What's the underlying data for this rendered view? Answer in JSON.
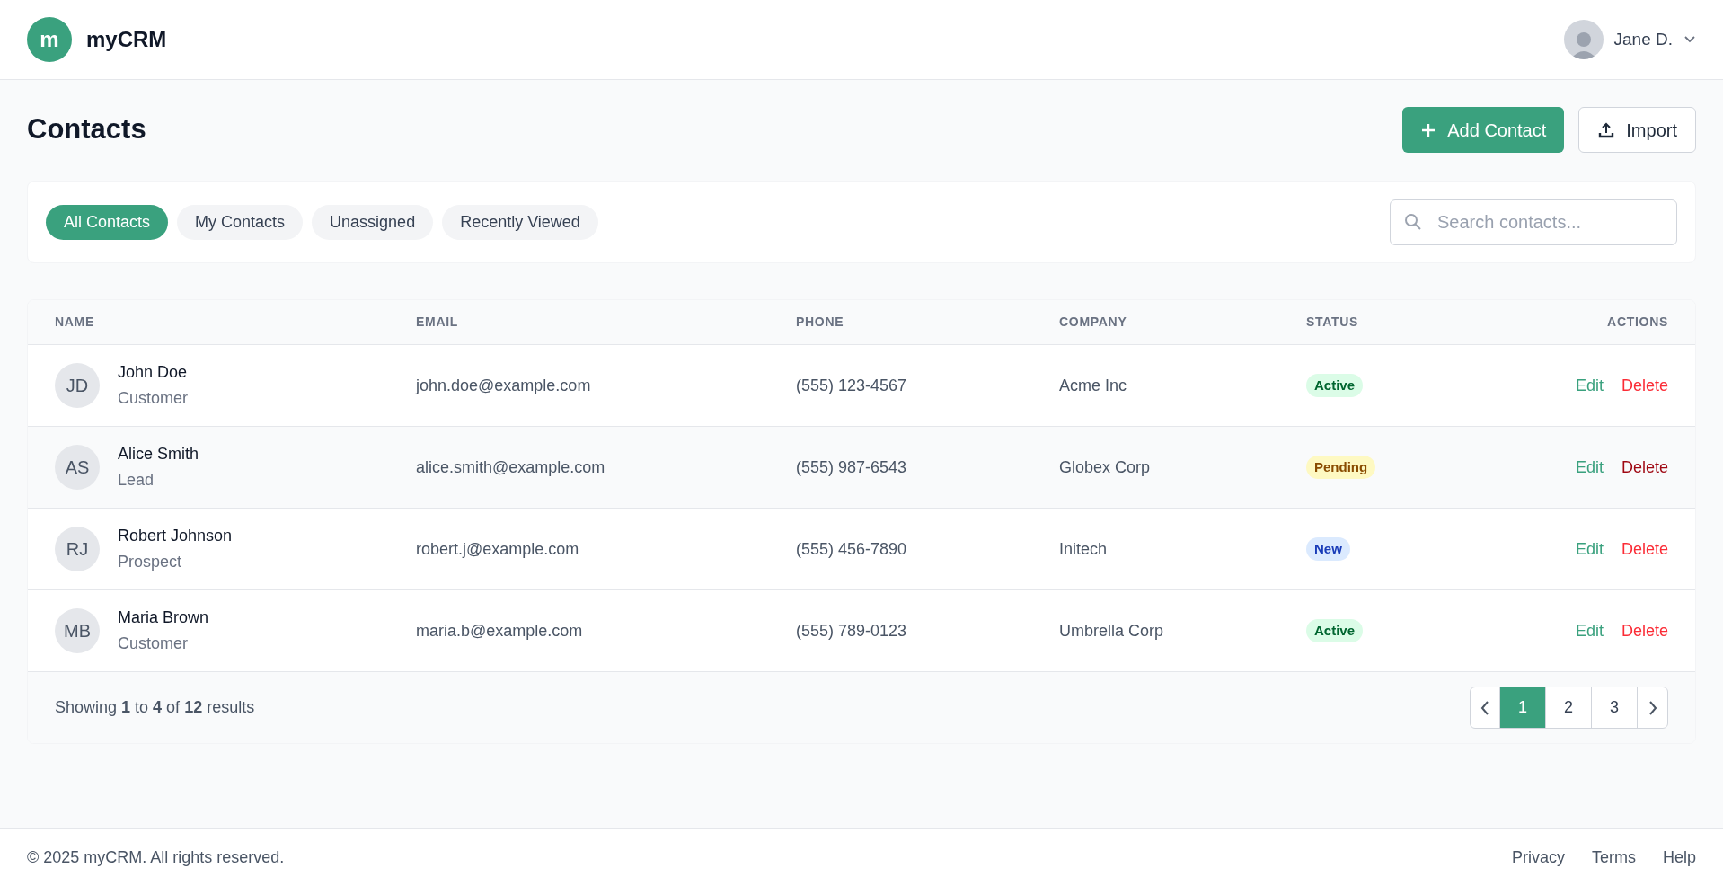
{
  "header": {
    "logo_letter": "m",
    "app_name": "myCRM",
    "user_name": "Jane D."
  },
  "page": {
    "title": "Contacts",
    "buttons": [
      {
        "kind": "primary",
        "label": "Add Contact"
      },
      {
        "kind": "secondary",
        "label": "Import"
      }
    ]
  },
  "filters": {
    "tabs": [
      {
        "label": "All Contacts",
        "selected": true
      },
      {
        "label": "My Contacts",
        "selected": false
      },
      {
        "label": "Unassigned",
        "selected": false
      },
      {
        "label": "Recently Viewed",
        "selected": false
      }
    ],
    "search": {
      "placeholder": "Search contacts..."
    }
  },
  "table": {
    "columns": [
      "NAME",
      "EMAIL",
      "PHONE",
      "COMPANY",
      "STATUS",
      "ACTIONS"
    ],
    "rows": [
      {
        "initials": "JD",
        "name": "John Doe",
        "type": "Customer",
        "email": "john.doe@example.com",
        "phone": "(555) 123-4567",
        "company": "Acme Inc",
        "status": {
          "label": "Active",
          "kind": "active"
        },
        "actions": [
          "Edit",
          "Delete"
        ],
        "highlighted": false
      },
      {
        "initials": "AS",
        "name": "Alice Smith",
        "type": "Lead",
        "email": "alice.smith@example.com",
        "phone": "(555) 987-6543",
        "company": "Globex Corp",
        "status": {
          "label": "Pending",
          "kind": "pending"
        },
        "actions": [
          "Edit",
          "Delete"
        ],
        "highlighted": true
      },
      {
        "initials": "RJ",
        "name": "Robert Johnson",
        "type": "Prospect",
        "email": "robert.j@example.com",
        "phone": "(555) 456-7890",
        "company": "Initech",
        "status": {
          "label": "New",
          "kind": "new"
        },
        "actions": [
          "Edit",
          "Delete"
        ],
        "highlighted": false
      },
      {
        "initials": "MB",
        "name": "Maria Brown",
        "type": "Customer",
        "email": "maria.b@example.com",
        "phone": "(555) 789-0123",
        "company": "Umbrella Corp",
        "status": {
          "label": "Active",
          "kind": "active"
        },
        "actions": [
          "Edit",
          "Delete"
        ],
        "highlighted": false
      }
    ],
    "summary": "Showing **1** to **4** of **12** results",
    "pagination": {
      "pages": [
        {
          "label": "1",
          "selected": true
        },
        {
          "label": "2",
          "selected": false
        },
        {
          "label": "3",
          "selected": false
        }
      ]
    }
  },
  "footer": {
    "copyright": "© 2025 myCRM. All rights reserved.",
    "links": [
      "Privacy",
      "Terms",
      "Help"
    ]
  }
}
